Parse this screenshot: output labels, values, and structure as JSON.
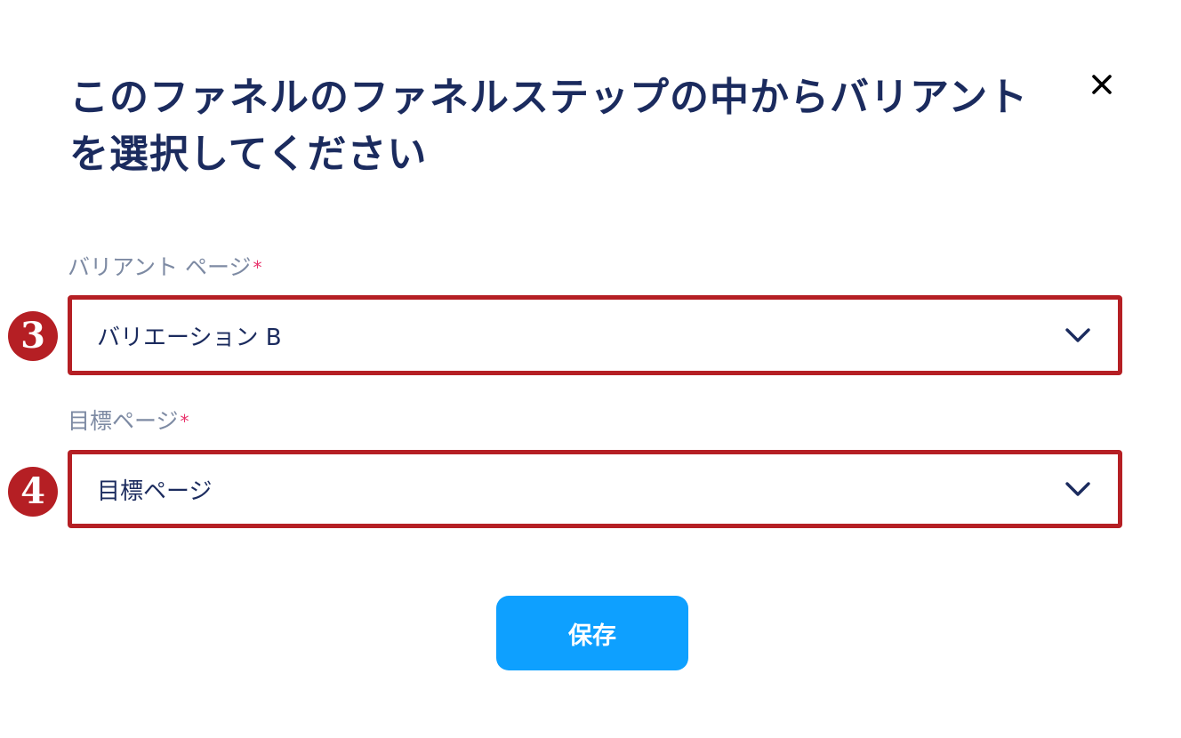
{
  "dialog": {
    "title": "このファネルのファネルステップの中からバリアントを選択してください",
    "close_icon": "close-icon"
  },
  "fields": {
    "variant_page": {
      "label": "バリアント ページ",
      "required_mark": "*",
      "value": "バリエーション B",
      "step_number": "3"
    },
    "goal_page": {
      "label": "目標ページ",
      "required_mark": "*",
      "value": "目標ページ",
      "step_number": "4"
    }
  },
  "actions": {
    "save_label": "保存"
  },
  "colors": {
    "title": "#1b2b5e",
    "label": "#7d8aa3",
    "required": "#e8336b",
    "highlight": "#b51f24",
    "primary": "#0ea0ff"
  }
}
